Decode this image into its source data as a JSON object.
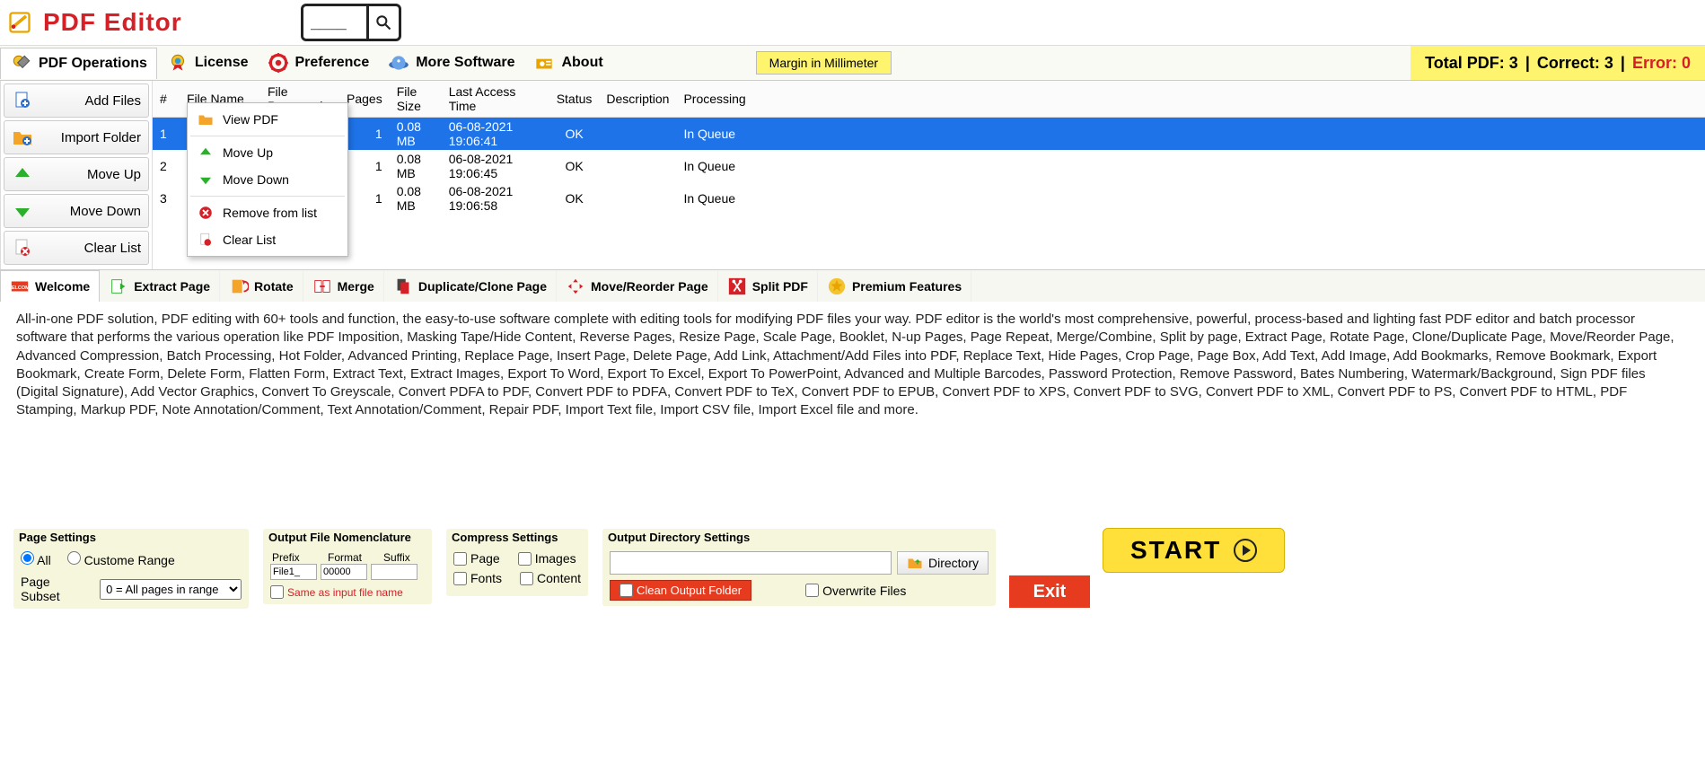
{
  "app": {
    "title": "PDF Editor"
  },
  "search": {
    "value": "____"
  },
  "toolbar": {
    "pdf_ops": "PDF Operations",
    "license": "License",
    "preference": "Preference",
    "more_software": "More Software",
    "about": "About",
    "margin_badge": "Margin in Millimeter"
  },
  "status": {
    "total_label": "Total PDF:",
    "total": "3",
    "correct_label": "Correct:",
    "correct": "3",
    "error_label": "Error:",
    "error": "0"
  },
  "side": {
    "add_files": "Add Files",
    "import_folder": "Import Folder",
    "move_up": "Move Up",
    "move_down": "Move Down",
    "clear_list": "Clear List"
  },
  "table": {
    "headers": {
      "num": "#",
      "file_name": "File Name",
      "file_password": "File Password",
      "pages": "Pages",
      "file_size": "File Size",
      "last_access": "Last Access Time",
      "status": "Status",
      "description": "Description",
      "processing": "Processing"
    },
    "rows": [
      {
        "num": "1",
        "file_name": "",
        "file_password": "",
        "pages": "1",
        "file_size": "0.08 MB",
        "last_access": "06-08-2021 19:06:41",
        "status": "OK",
        "description": "",
        "processing": "In Queue"
      },
      {
        "num": "2",
        "file_name": "",
        "file_password": "",
        "pages": "1",
        "file_size": "0.08 MB",
        "last_access": "06-08-2021 19:06:45",
        "status": "OK",
        "description": "",
        "processing": "In Queue"
      },
      {
        "num": "3",
        "file_name": "",
        "file_password": "",
        "pages": "1",
        "file_size": "0.08 MB",
        "last_access": "06-08-2021 19:06:58",
        "status": "OK",
        "description": "",
        "processing": "In Queue"
      }
    ]
  },
  "ctx": {
    "view_pdf": "View PDF",
    "move_up": "Move Up",
    "move_down": "Move Down",
    "remove": "Remove from list",
    "clear": "Clear List"
  },
  "tabs": {
    "welcome": "Welcome",
    "extract": "Extract Page",
    "rotate": "Rotate",
    "merge": "Merge",
    "duplicate": "Duplicate/Clone Page",
    "move": "Move/Reorder Page",
    "split": "Split PDF",
    "premium": "Premium Features"
  },
  "description": "All-in-one PDF solution, PDF editing with 60+ tools and function, the easy-to-use software complete with editing tools for modifying PDF files your way. PDF editor is the world's most comprehensive, powerful, process-based and lighting fast PDF editor and batch processor software that performs the various operation like PDF Imposition, Masking Tape/Hide Content, Reverse Pages, Resize Page, Scale Page, Booklet, N-up Pages, Page Repeat, Merge/Combine, Split by page, Extract Page, Rotate Page, Clone/Duplicate Page, Move/Reorder Page, Advanced Compression, Batch Processing, Hot Folder, Advanced Printing, Replace Page, Insert Page, Delete Page, Add Link, Attachment/Add Files into PDF, Replace Text, Hide Pages, Crop Page, Page Box, Add Text, Add Image, Add Bookmarks, Remove Bookmark, Export Bookmark, Create Form, Delete Form, Flatten Form, Extract Text, Extract Images, Export To Word, Export To Excel, Export To PowerPoint, Advanced and Multiple Barcodes, Password Protection, Remove Password, Bates Numbering,  Watermark/Background, Sign PDF files (Digital Signature), Add Vector Graphics, Convert To Greyscale, Convert PDFA to PDF, Convert PDF to PDFA, Convert PDF to TeX, Convert PDF to EPUB, Convert PDF to XPS, Convert PDF to SVG, Convert PDF to XML, Convert PDF to PS, Convert PDF to HTML, PDF Stamping, Markup PDF, Note Annotation/Comment, Text Annotation/Comment, Repair PDF, Import Text file, Import CSV file, Import Excel file and more.",
  "page_settings": {
    "title": "Page Settings",
    "all": "All",
    "custom": "Custome Range",
    "subset_label": "Page Subset",
    "subset_value": "0 = All pages in range"
  },
  "nomen": {
    "title": "Output File Nomenclature",
    "prefix_label": "Prefix",
    "format_label": "Format",
    "suffix_label": "Suffix",
    "prefix": "File1_",
    "format": "00000",
    "suffix": "",
    "same": "Same as input file name"
  },
  "compress": {
    "title": "Compress Settings",
    "page": "Page",
    "images": "Images",
    "fonts": "Fonts",
    "content": "Content"
  },
  "outdir": {
    "title": "Output Directory Settings",
    "value": "",
    "dir_btn": "Directory",
    "clean": "Clean Output Folder",
    "overwrite": "Overwrite Files"
  },
  "exit": "Exit",
  "start": "START"
}
